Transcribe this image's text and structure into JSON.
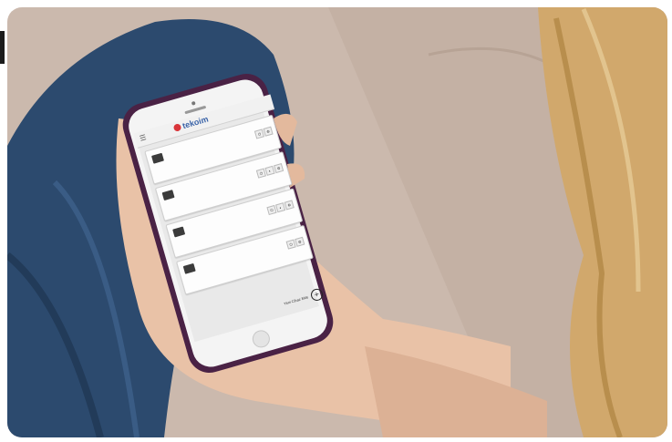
{
  "app": {
    "logo_text": "tekoim",
    "menu_icon": "hamburger-icon",
    "add_label": "Yeni Cihaz Ekle",
    "add_icon": "plus-circle-icon"
  },
  "devices": [
    {
      "title": "",
      "meta": "",
      "buttons": 2
    },
    {
      "title": "",
      "meta": "",
      "buttons": 3
    },
    {
      "title": "",
      "meta": "",
      "buttons": 3
    },
    {
      "title": "",
      "meta": "",
      "buttons": 2
    }
  ],
  "colors": {
    "sofa": "#cbb9ad",
    "jeans": "#2c4a6e",
    "skin": "#e9c2a7",
    "hair": "#d1a86c",
    "phone_case": "#4a2245",
    "logo_accent": "#d9353a"
  }
}
